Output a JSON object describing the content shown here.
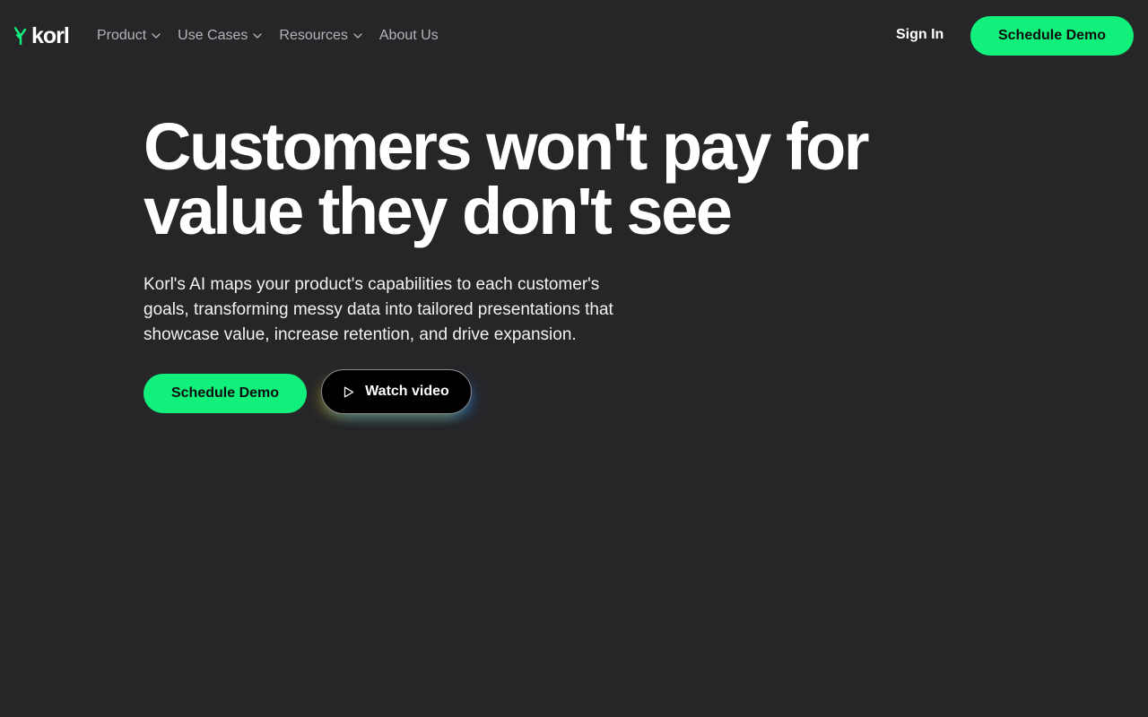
{
  "brand": {
    "name": "korl",
    "accent_color": "#12f07c",
    "background_color": "#262628"
  },
  "nav": {
    "items": [
      {
        "label": "Product",
        "has_dropdown": true
      },
      {
        "label": "Use Cases",
        "has_dropdown": true
      },
      {
        "label": "Resources",
        "has_dropdown": true
      },
      {
        "label": "About Us",
        "has_dropdown": false
      }
    ],
    "icon": "chevron-down-icon"
  },
  "header": {
    "signin_label": "Sign In",
    "cta_label": "Schedule Demo"
  },
  "hero": {
    "title_lines": [
      "Customers won't pay for",
      "value they don't see"
    ],
    "subtitle_lines": [
      "Korl's AI maps your product's capabilities to each customer's",
      "goals, transforming messy data into tailored presentations that",
      "showcase value, increase retention, and drive expansion."
    ],
    "cta_label": "Schedule Demo",
    "video_label": "Watch video",
    "video_icon": "play-icon"
  }
}
